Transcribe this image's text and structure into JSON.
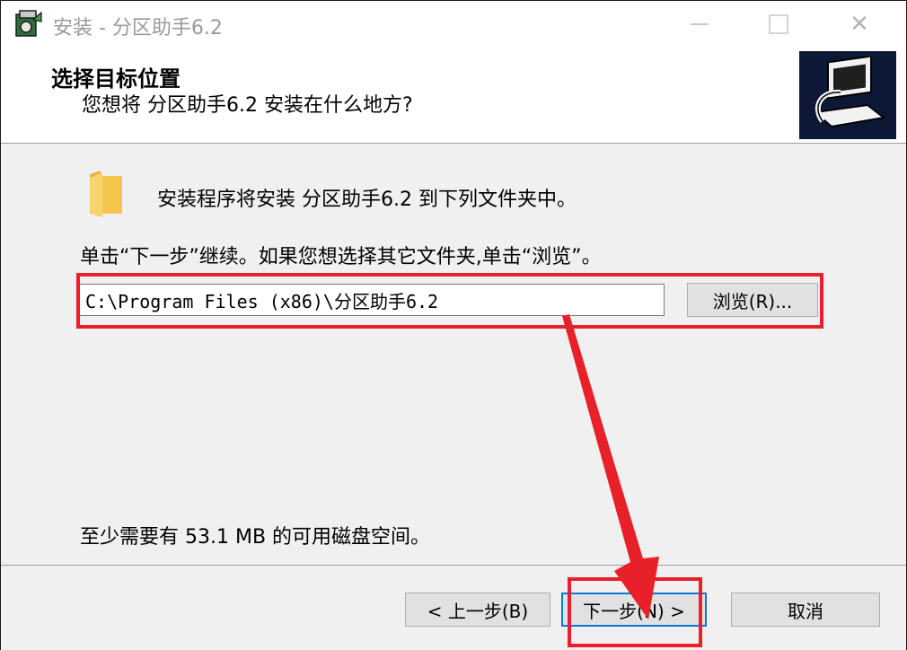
{
  "window": {
    "title": "安装 - 分区助手6.2",
    "minimize_icon": "minimize-icon",
    "maximize_icon": "maximize-icon",
    "close_glyph": "✕"
  },
  "header": {
    "title": "选择目标位置",
    "subtitle": "您想将 分区助手6.2 安装在什么地方?"
  },
  "body": {
    "intro": "安装程序将安装 分区助手6.2 到下列文件夹中。",
    "hint": "单击“下一步”继续。如果您想选择其它文件夹,单击“浏览”。",
    "path_value": "C:\\Program Files (x86)\\分区助手6.2",
    "browse_label": "浏览(R)...",
    "disk_space": "至少需要有 53.1 MB 的可用磁盘空间。"
  },
  "footer": {
    "back_label": "< 上一步(B)",
    "next_label": "下一步(N) >",
    "cancel_label": "取消"
  },
  "colors": {
    "highlight": "#e8202a",
    "focus_border": "#0a78d7",
    "panel_bg": "#f0f0f0"
  }
}
